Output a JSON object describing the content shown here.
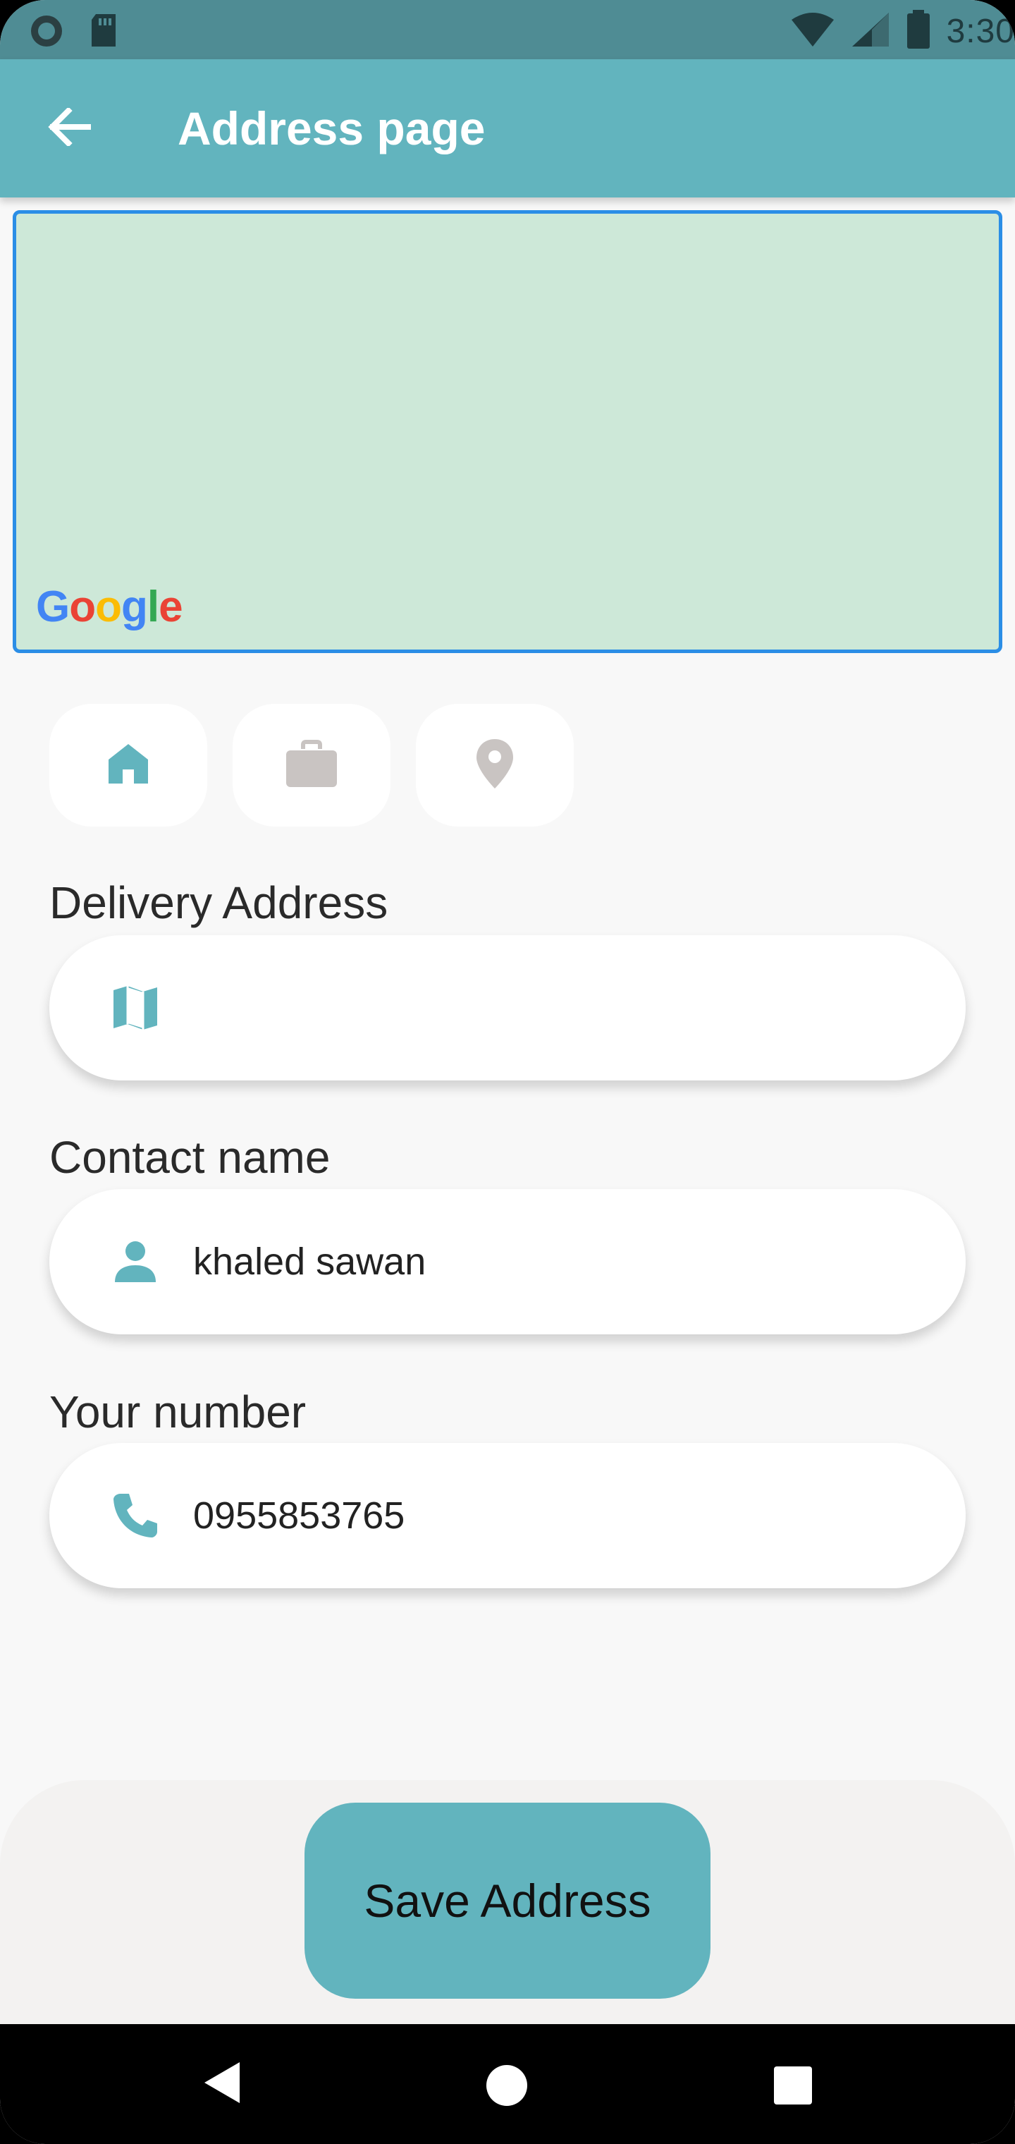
{
  "status_bar": {
    "time": "3:30"
  },
  "app_bar": {
    "title": "Address page"
  },
  "map": {
    "attribution": "Google"
  },
  "categories": [
    {
      "name": "home",
      "icon": "home-icon",
      "selected": true
    },
    {
      "name": "work",
      "icon": "briefcase-icon",
      "selected": false
    },
    {
      "name": "other",
      "icon": "location-pin-icon",
      "selected": false
    }
  ],
  "form": {
    "delivery_address": {
      "label": "Delivery Address",
      "value": "",
      "icon": "map-icon"
    },
    "contact_name": {
      "label": "Contact name",
      "value": "khaled sawan",
      "icon": "person-icon"
    },
    "phone_number": {
      "label": "Your number",
      "value": "0955853765",
      "icon": "phone-icon"
    }
  },
  "save_button": {
    "label": "Save Address"
  },
  "colors": {
    "accent": "#62b4be",
    "status_bar": "#4f8c94",
    "map_background": "#cde8d8",
    "map_border": "#2b8ee6",
    "inactive_icon": "#c9c4c2"
  }
}
